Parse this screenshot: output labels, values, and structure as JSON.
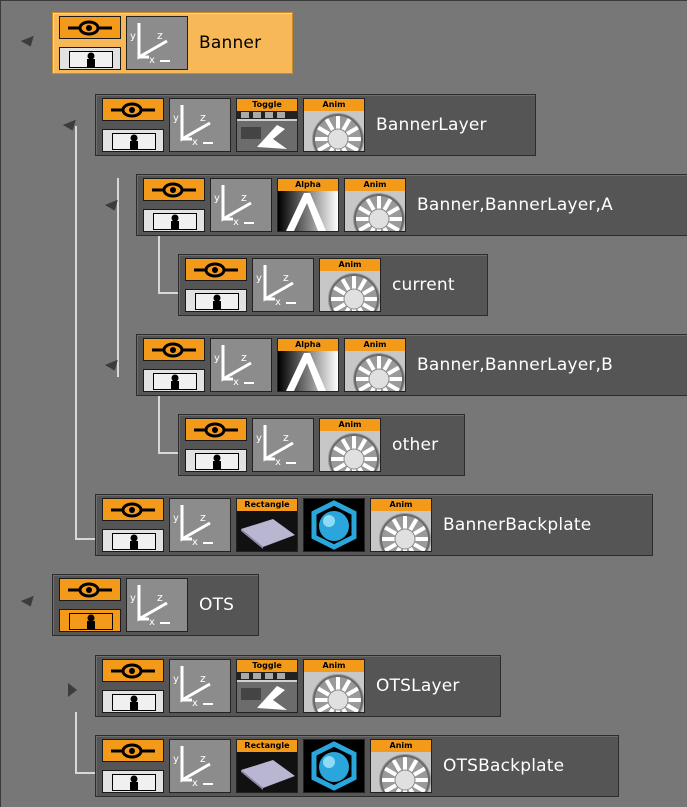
{
  "tree": [
    {
      "label": "Banner",
      "selected": true,
      "expanded": true,
      "render_on": false,
      "plugins": []
    },
    {
      "label": "BannerLayer",
      "selected": false,
      "expanded": true,
      "render_on": false,
      "plugins": [
        "Toggle",
        "Anim"
      ]
    },
    {
      "label": "Banner,BannerLayer,A",
      "selected": false,
      "expanded": true,
      "render_on": false,
      "plugins": [
        "Alpha",
        "Anim"
      ]
    },
    {
      "label": "current",
      "selected": false,
      "expanded": false,
      "render_on": false,
      "plugins": [
        "Anim"
      ]
    },
    {
      "label": "Banner,BannerLayer,B",
      "selected": false,
      "expanded": true,
      "render_on": false,
      "plugins": [
        "Alpha",
        "Anim"
      ]
    },
    {
      "label": "other",
      "selected": false,
      "expanded": false,
      "render_on": false,
      "plugins": [
        "Anim"
      ]
    },
    {
      "label": "BannerBackplate",
      "selected": false,
      "expanded": false,
      "render_on": false,
      "plugins": [
        "Rectangle",
        "Material",
        "Anim"
      ]
    },
    {
      "label": "OTS",
      "selected": false,
      "expanded": true,
      "render_on": true,
      "plugins": []
    },
    {
      "label": "OTSLayer",
      "selected": false,
      "expanded": false,
      "render_on": false,
      "plugins": [
        "Toggle",
        "Anim"
      ]
    },
    {
      "label": "OTSBackplate",
      "selected": false,
      "expanded": false,
      "render_on": false,
      "plugins": [
        "Rectangle",
        "Material",
        "Anim"
      ]
    }
  ],
  "plugin_tags": {
    "toggle": "Toggle",
    "anim": "Anim",
    "alpha": "Alpha",
    "rectangle": "Rectangle"
  },
  "colors": {
    "accent": "#f39a1a",
    "selected": "#f7b858",
    "node": "#555555",
    "background": "#777777"
  }
}
